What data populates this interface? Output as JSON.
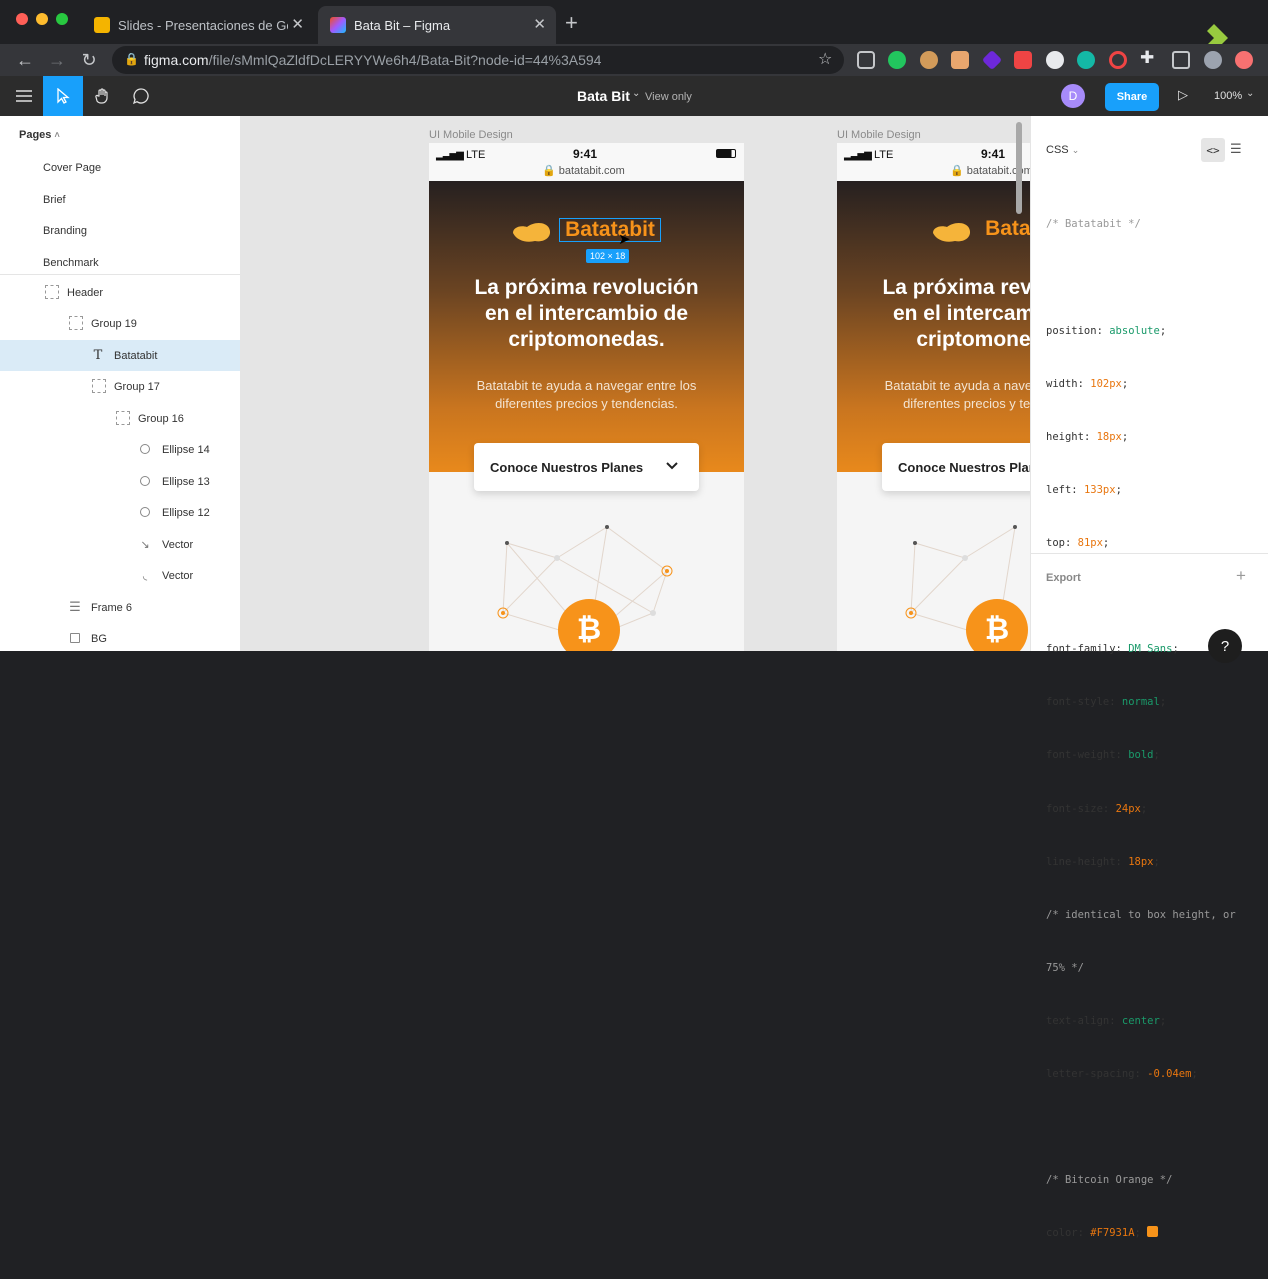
{
  "browser": {
    "tabs": [
      {
        "label": "Slides - Presentaciones de Go",
        "active": false
      },
      {
        "label": "Bata Bit – Figma",
        "active": true
      }
    ],
    "url_host": "figma.com",
    "url_path": "/file/sMmlQaZldfDcLERYYWe6h4/Bata-Bit?node-id=44%3A594"
  },
  "figma_toolbar": {
    "file_name": "Bata Bit",
    "view_mode": "View only",
    "avatar_letter": "D",
    "share_label": "Share",
    "zoom": "100%"
  },
  "layers_panel": {
    "pages_label": "Pages",
    "pages": [
      "Cover Page",
      "Brief",
      "Branding",
      "Benchmark"
    ],
    "layers": [
      {
        "name": "Header",
        "icon": "frame-dotted-icon"
      },
      {
        "name": "Group 19",
        "icon": "group-icon"
      },
      {
        "name": "Batatabit",
        "icon": "text-icon",
        "selected": true
      },
      {
        "name": "Group 17",
        "icon": "group-icon"
      },
      {
        "name": "Group 16",
        "icon": "group-icon"
      },
      {
        "name": "Ellipse 14",
        "icon": "ellipse-icon"
      },
      {
        "name": "Ellipse 13",
        "icon": "ellipse-icon"
      },
      {
        "name": "Ellipse 12",
        "icon": "ellipse-icon"
      },
      {
        "name": "Vector",
        "icon": "vector-icon"
      },
      {
        "name": "Vector",
        "icon": "vector-icon"
      },
      {
        "name": "Frame 6",
        "icon": "frame-icon"
      },
      {
        "name": "BG",
        "icon": "rectangle-icon"
      }
    ]
  },
  "canvas": {
    "frames": [
      {
        "label": "UI Mobile Design",
        "carrier": "LTE",
        "time": "9:41",
        "url": "batatabit.com",
        "logo_text": "Batatabit",
        "dimension_badge": "102 × 18",
        "headline": [
          "La próxima revolución",
          "en el intercambio de",
          "criptomonedas."
        ],
        "subtext": [
          "Batatabit te ayuda a navegar entre los",
          "diferentes precios y tendencias."
        ],
        "button_label": "Conoce Nuestros Planes"
      },
      {
        "label": "UI Mobile Design",
        "carrier": "LTE",
        "time": "9:41",
        "url": "batatabit.com",
        "logo_text": "Batatabit",
        "headline": [
          "La próxima revolución",
          "en el intercambio de",
          "criptomonedas."
        ],
        "subtext": [
          "Batatabit te ayuda a navegar entre los",
          "diferentes precios y tendencias."
        ],
        "button_label": "Conoce Nuestros Planes"
      }
    ]
  },
  "inspect_panel": {
    "tab_label": "CSS",
    "comment_name": "/* Batatabit */",
    "props": [
      {
        "key": "position",
        "value": "absolute",
        "kind": "v"
      },
      {
        "key": "width",
        "value": "102px",
        "kind": "n"
      },
      {
        "key": "height",
        "value": "18px",
        "kind": "n"
      },
      {
        "key": "left",
        "value": "133px",
        "kind": "n"
      },
      {
        "key": "top",
        "value": "81px",
        "kind": "n"
      }
    ],
    "font_props": [
      {
        "key": "font-family",
        "value": "DM Sans",
        "kind": "v"
      },
      {
        "key": "font-style",
        "value": "normal",
        "kind": "v"
      },
      {
        "key": "font-weight",
        "value": "bold",
        "kind": "v"
      },
      {
        "key": "font-size",
        "value": "24px",
        "kind": "n"
      },
      {
        "key": "line-height",
        "value": "18px",
        "kind": "n"
      }
    ],
    "line_height_comment": [
      "/* identical to box height, or",
      "75% */"
    ],
    "text_props": [
      {
        "key": "text-align",
        "value": "center",
        "kind": "v"
      },
      {
        "key": "letter-spacing",
        "value": "-0.04em",
        "kind": "n"
      }
    ],
    "color_comment": "/* Bitcoin Orange */",
    "color_key": "color",
    "color_value": "#F7931A",
    "export_label": "Export"
  },
  "colors": {
    "figma_blue": "#18a0fb",
    "bitcoin_orange": "#F7931A"
  }
}
